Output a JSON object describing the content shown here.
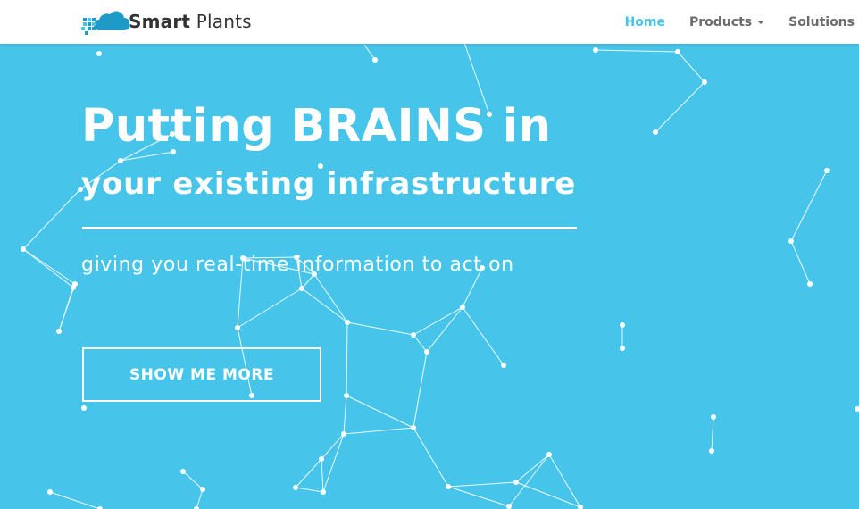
{
  "colors": {
    "accent": "#47c4ea",
    "hero_background": "#47c4ea",
    "nav_text": "#6b6b6b",
    "logo_cloud": "#1e9ac8",
    "white": "#ffffff"
  },
  "brand": {
    "name_bold": "Smart",
    "name_light": " Plants",
    "logo_icon": "cloud-pixels-icon"
  },
  "nav": {
    "items": [
      {
        "label": "Home",
        "active": true
      },
      {
        "label": "Products",
        "has_dropdown": true,
        "icon": "caret-down-icon"
      },
      {
        "label": "Solutions"
      }
    ]
  },
  "hero": {
    "headline_line1": "Putting BRAINS in",
    "headline_line2": "your existing infrastructure",
    "tagline": "giving you real-time information to act on",
    "cta_label": "SHOW ME MORE",
    "background_decoration": "network-graph"
  }
}
